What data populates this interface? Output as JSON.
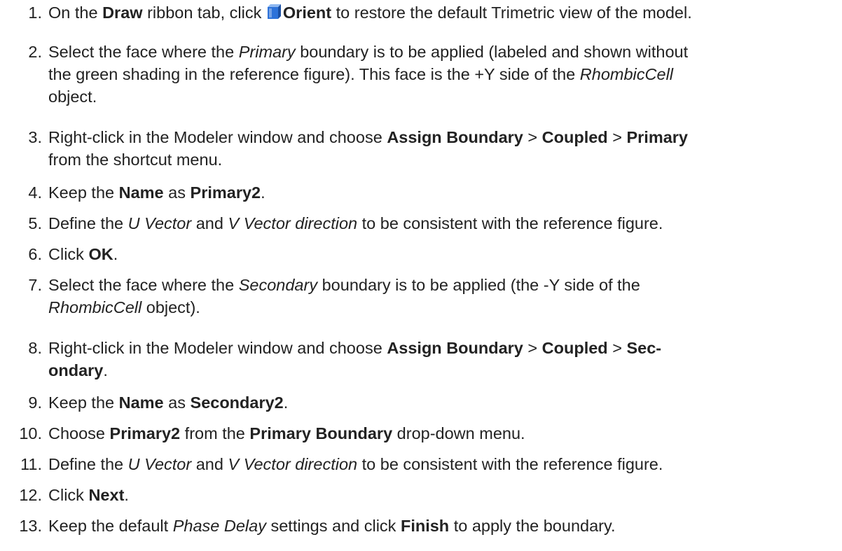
{
  "steps": [
    {
      "number": "1.",
      "parts": [
        {
          "t": "On the "
        },
        {
          "t": "Draw",
          "b": true
        },
        {
          "t": " ribbon tab, click "
        },
        {
          "icon": "orient-cube-icon"
        },
        {
          "t": "Orient",
          "b": true
        },
        {
          "t": " to restore the default Trimetric view of the model."
        }
      ]
    },
    {
      "number": "2.",
      "parts": [
        {
          "t": "Select the face where the "
        },
        {
          "t": "Primary",
          "i": true
        },
        {
          "t": " boundary is to be applied (labeled and shown without"
        },
        {
          "br": true
        },
        {
          "t": "the green shading in the reference figure). This face is the +Y side of the "
        },
        {
          "t": "RhombicCell",
          "i": true
        },
        {
          "br": true
        },
        {
          "t": "object."
        }
      ]
    },
    {
      "number": "3.",
      "parts": [
        {
          "t": "Right-click in the Modeler window and choose "
        },
        {
          "t": "Assign Boundary",
          "b": true
        },
        {
          "t": " > "
        },
        {
          "t": "Coupled",
          "b": true
        },
        {
          "t": " > "
        },
        {
          "t": "Primary",
          "b": true
        },
        {
          "br": true
        },
        {
          "t": "from the shortcut menu."
        }
      ]
    },
    {
      "number": "4.",
      "parts": [
        {
          "t": "Keep the "
        },
        {
          "t": "Name",
          "b": true
        },
        {
          "t": " as "
        },
        {
          "t": "Primary2",
          "b": true
        },
        {
          "t": "."
        }
      ]
    },
    {
      "number": "5.",
      "parts": [
        {
          "t": "Define the "
        },
        {
          "t": "U Vector",
          "i": true
        },
        {
          "t": " and "
        },
        {
          "t": "V Vector direction",
          "i": true
        },
        {
          "t": " to be consistent with the reference figure."
        }
      ]
    },
    {
      "number": "6.",
      "parts": [
        {
          "t": "Click "
        },
        {
          "t": "OK",
          "b": true
        },
        {
          "t": "."
        }
      ]
    },
    {
      "number": "7.",
      "parts": [
        {
          "t": "Select the face where the "
        },
        {
          "t": "Secondary",
          "i": true
        },
        {
          "t": " boundary is to be applied (the -Y side of the"
        },
        {
          "br": true
        },
        {
          "t": "RhombicCell",
          "i": true
        },
        {
          "t": " object)."
        }
      ]
    },
    {
      "number": "8.",
      "parts": [
        {
          "t": "Right-click in the Modeler window and choose "
        },
        {
          "t": "Assign Boundary",
          "b": true
        },
        {
          "t": " > "
        },
        {
          "t": "Coupled",
          "b": true
        },
        {
          "t": " > "
        },
        {
          "t": "Sec-",
          "b": true
        },
        {
          "br": true
        },
        {
          "t": "ondary",
          "b": true
        },
        {
          "t": "."
        }
      ]
    },
    {
      "number": "9.",
      "parts": [
        {
          "t": "Keep the "
        },
        {
          "t": "Name",
          "b": true
        },
        {
          "t": " as "
        },
        {
          "t": "Secondary2",
          "b": true
        },
        {
          "t": "."
        }
      ]
    },
    {
      "number": "10.",
      "parts": [
        {
          "t": "Choose "
        },
        {
          "t": "Primary2",
          "b": true
        },
        {
          "t": " from the "
        },
        {
          "t": "Primary Boundary",
          "b": true
        },
        {
          "t": " drop-down menu."
        }
      ]
    },
    {
      "number": "11.",
      "parts": [
        {
          "t": "Define the "
        },
        {
          "t": "U Vector",
          "i": true
        },
        {
          "t": " and "
        },
        {
          "t": "V Vector direction",
          "i": true
        },
        {
          "t": " to be consistent with the reference figure."
        }
      ]
    },
    {
      "number": "12.",
      "parts": [
        {
          "t": "Click "
        },
        {
          "t": "Next",
          "b": true
        },
        {
          "t": "."
        }
      ]
    },
    {
      "number": "13.",
      "parts": [
        {
          "t": "Keep the default "
        },
        {
          "t": "Phase Delay",
          "i": true
        },
        {
          "t": " settings and click "
        },
        {
          "t": "Finish",
          "b": true
        },
        {
          "t": " to apply the boundary."
        }
      ]
    }
  ],
  "colors": {
    "text": "#222222",
    "icon_front": "#2d72d9",
    "icon_top": "#8fb8f0",
    "icon_side": "#1a4fa3"
  }
}
